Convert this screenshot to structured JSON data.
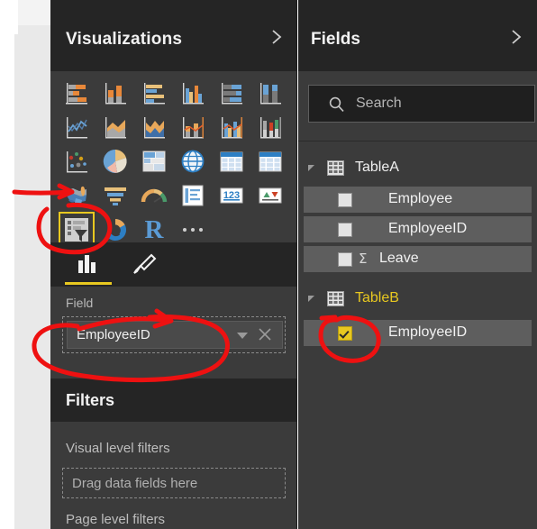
{
  "visualizations": {
    "title": "Visualizations",
    "collapse_icon": "chevron-right-icon",
    "gallery": [
      {
        "name": "stacked-bar-chart",
        "row": 0,
        "col": 0
      },
      {
        "name": "stacked-column-chart",
        "row": 0,
        "col": 1
      },
      {
        "name": "clustered-bar-chart",
        "row": 0,
        "col": 2
      },
      {
        "name": "clustered-column-chart",
        "row": 0,
        "col": 3
      },
      {
        "name": "hundred-percent-stacked-bar-chart",
        "row": 0,
        "col": 4
      },
      {
        "name": "hundred-percent-stacked-column-chart",
        "row": 0,
        "col": 5
      },
      {
        "name": "line-chart",
        "row": 1,
        "col": 0
      },
      {
        "name": "area-chart",
        "row": 1,
        "col": 1
      },
      {
        "name": "stacked-area-chart",
        "row": 1,
        "col": 2
      },
      {
        "name": "line-and-stacked-column-chart",
        "row": 1,
        "col": 3
      },
      {
        "name": "line-and-clustered-column-chart",
        "row": 1,
        "col": 4
      },
      {
        "name": "ribbon-chart",
        "row": 1,
        "col": 5
      },
      {
        "name": "scatter-chart",
        "row": 2,
        "col": 0
      },
      {
        "name": "pie-chart",
        "row": 2,
        "col": 1
      },
      {
        "name": "treemap-chart",
        "row": 2,
        "col": 2
      },
      {
        "name": "map-globe",
        "row": 2,
        "col": 3
      },
      {
        "name": "table-visual",
        "row": 2,
        "col": 4
      },
      {
        "name": "matrix-visual",
        "row": 2,
        "col": 5
      },
      {
        "name": "filled-map",
        "row": 3,
        "col": 0
      },
      {
        "name": "funnel-chart",
        "row": 3,
        "col": 1
      },
      {
        "name": "gauge-chart",
        "row": 3,
        "col": 2
      },
      {
        "name": "multi-row-card",
        "row": 3,
        "col": 3
      },
      {
        "name": "card-visual",
        "row": 3,
        "col": 4
      },
      {
        "name": "kpi-visual",
        "row": 3,
        "col": 5
      },
      {
        "name": "slicer-visual",
        "row": 4,
        "col": 0,
        "selected": true
      },
      {
        "name": "donut-chart",
        "row": 4,
        "col": 1
      },
      {
        "name": "r-script-visual",
        "row": 4,
        "col": 2,
        "glyph": "R"
      },
      {
        "name": "more-visuals-ellipsis",
        "row": 4,
        "col": 3
      }
    ],
    "tabs": [
      {
        "name": "fields-tab",
        "icon": "bar-chart-icon",
        "selected": true
      },
      {
        "name": "format-tab",
        "icon": "paintbrush-icon",
        "selected": false
      }
    ],
    "field_well": {
      "label": "Field",
      "chip_value": "EmployeeID",
      "caret_icon": "chevron-down-icon",
      "remove_icon": "close-icon"
    },
    "filters": {
      "title": "Filters",
      "visual_level_label": "Visual level filters",
      "dropzone_placeholder": "Drag data fields here",
      "page_level_label": "Page level filters"
    }
  },
  "fields": {
    "title": "Fields",
    "collapse_icon": "chevron-right-icon",
    "search": {
      "placeholder": "Search",
      "value": "",
      "icon": "search-icon"
    },
    "tables": [
      {
        "name": "TableA",
        "expanded": true,
        "highlighted": false,
        "items": [
          {
            "label": "Employee",
            "checked": false,
            "aggregate": false
          },
          {
            "label": "EmployeeID",
            "checked": false,
            "aggregate": false
          },
          {
            "label": "Leave",
            "checked": false,
            "aggregate": true,
            "aggregate_symbol": "Σ"
          }
        ]
      },
      {
        "name": "TableB",
        "expanded": true,
        "highlighted": true,
        "items": [
          {
            "label": "EmployeeID",
            "checked": true,
            "aggregate": false
          }
        ]
      }
    ]
  },
  "annotations": {
    "color": "#ee1111",
    "marks": [
      {
        "name": "annotation-circle-slicer-icon",
        "target": "slicer-visual"
      },
      {
        "name": "annotation-circle-field-well",
        "target": "field-well-chip"
      },
      {
        "name": "annotation-circle-tableb-checkbox",
        "target": "tableb-employeeid-checkbox"
      },
      {
        "name": "annotation-arrow-to-slicer",
        "target": "slicer-visual"
      },
      {
        "name": "annotation-arrow-to-field-well",
        "target": "field-well-chip"
      }
    ]
  },
  "theme": {
    "pane_bg": "#3b3b3b",
    "header_bg": "#252525",
    "accent": "#e8c820",
    "text": "#f2f2f2",
    "row_bg": "#5e5e5e"
  }
}
